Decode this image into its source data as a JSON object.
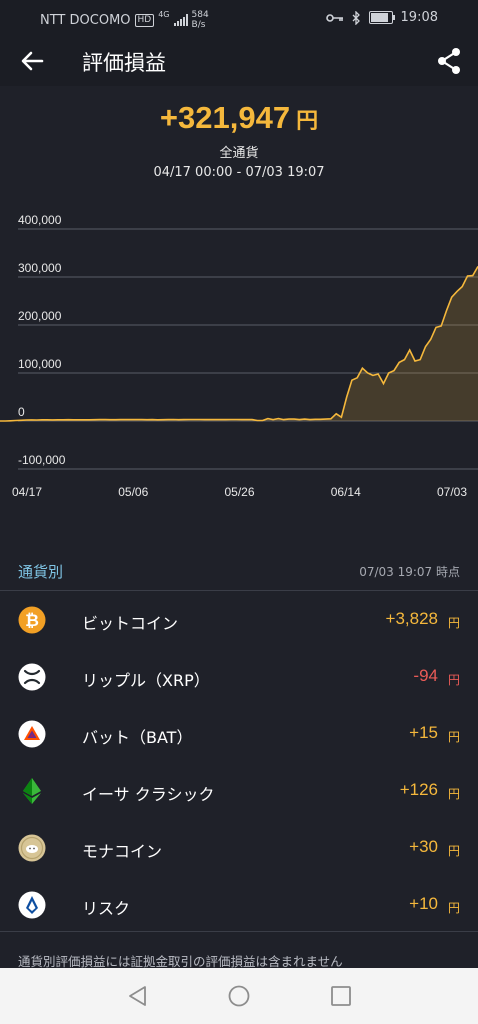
{
  "status_bar": {
    "carrier": "NTT DOCOMO",
    "hd": "HD",
    "network": "4G",
    "speed_top": "584",
    "speed_bottom": "B/s",
    "time": "19:08"
  },
  "header": {
    "title": "評価損益"
  },
  "summary": {
    "total": "+321,947",
    "unit": "円",
    "label": "全通貨",
    "range": "04/17 00:00 - 07/03 19:07"
  },
  "chart_data": {
    "type": "area",
    "y_ticks": [
      "400,000",
      "300,000",
      "200,000",
      "100,000",
      "0",
      "-100,000"
    ],
    "x_ticks": [
      "04/17",
      "05/06",
      "05/26",
      "06/14",
      "07/03"
    ],
    "ylim": [
      -100000,
      400000
    ],
    "grid": true,
    "line_color": "#f5b83c",
    "values": [
      0,
      0,
      500,
      1000,
      1500,
      2000,
      2200,
      2000,
      2500,
      2500,
      2300,
      2500,
      2600,
      2700,
      2400,
      2500,
      2600,
      2600,
      2700,
      3000,
      2900,
      2800,
      2800,
      3000,
      3100,
      3000,
      2900,
      3000,
      2800,
      3000,
      2600,
      2700,
      3000,
      3100,
      2800,
      3000,
      3100,
      3200,
      3100,
      3000,
      2900,
      3000,
      3100,
      3000,
      3200,
      3100,
      2900,
      3200,
      3000,
      1000,
      1000,
      5000,
      3000,
      5000,
      3000,
      4000,
      4000,
      3000,
      4000,
      3000,
      3500,
      3500,
      4000,
      4500,
      15000,
      8000,
      50000,
      85000,
      90000,
      110000,
      100000,
      95000,
      98000,
      78000,
      100000,
      105000,
      122000,
      128000,
      148000,
      125000,
      128000,
      155000,
      170000,
      195000,
      198000,
      230000,
      258000,
      270000,
      280000,
      302000,
      303000,
      322000
    ]
  },
  "section": {
    "title": "通貨別",
    "timestamp": "07/03 19:07 時点"
  },
  "currencies": [
    {
      "name": "ビットコイン",
      "value": "+3,828",
      "unit": "円",
      "icon": "bitcoin-icon"
    },
    {
      "name": "リップル（XRP）",
      "value": "-94",
      "unit": "円",
      "icon": "xrp-icon"
    },
    {
      "name": "バット（BAT）",
      "value": "+15",
      "unit": "円",
      "icon": "bat-icon"
    },
    {
      "name": "イーサ クラシック",
      "value": "+126",
      "unit": "円",
      "icon": "ethereum-classic-icon"
    },
    {
      "name": "モナコイン",
      "value": "+30",
      "unit": "円",
      "icon": "monacoin-icon"
    },
    {
      "name": "リスク",
      "value": "+10",
      "unit": "円",
      "icon": "lisk-icon"
    }
  ],
  "note": "通貨別評価損益には証拠金取引の評価損益は含まれません",
  "colors": {
    "accent": "#f5b83c",
    "negative": "#ea5b57",
    "section": "#7fc4e4",
    "background": "#1f2129"
  }
}
